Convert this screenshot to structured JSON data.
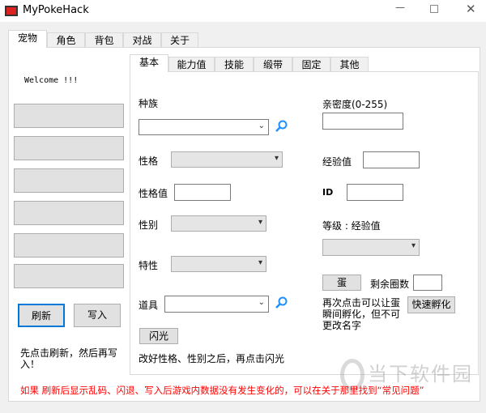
{
  "window": {
    "title": "MyPokeHack",
    "controls": [
      "minimize",
      "maximize",
      "close"
    ]
  },
  "outer_tabs": [
    "宠物",
    "角色",
    "背包",
    "对战",
    "关于"
  ],
  "welcome": "Welcome !!!",
  "left_buttons": {
    "refresh": "刷新",
    "write": "写入"
  },
  "left_hint": "先点击刷新，然后再写入！",
  "inner_tabs": [
    "基本",
    "能力值",
    "技能",
    "缎带",
    "固定",
    "其他"
  ],
  "form": {
    "species": "种族",
    "nature": "性格",
    "nature_value": "性格值",
    "gender": "性别",
    "ability": "特性",
    "item": "道具",
    "shiny_button": "闪光",
    "shiny_hint": "改好性格、性别之后，再点击闪光",
    "friendship": "亲密度(0-255)",
    "exp": "经验值",
    "id": "ID",
    "level_exp": "等级 : 经验值",
    "egg_button": "蛋",
    "remaining_cycles": "剩余圈数",
    "egg_hint": "再次点击可以让蛋瞬间孵化，但不可更改名字",
    "quick_hatch": "快速孵化"
  },
  "warning": "如果 刷新后显示乱码、闪退、写入后游戏内数据没有发生变化的，可以在关于那里找到“常见问题”",
  "watermark": "当下软件园",
  "colors": {
    "warning": "#ff0000",
    "search": "#1e90ff"
  }
}
